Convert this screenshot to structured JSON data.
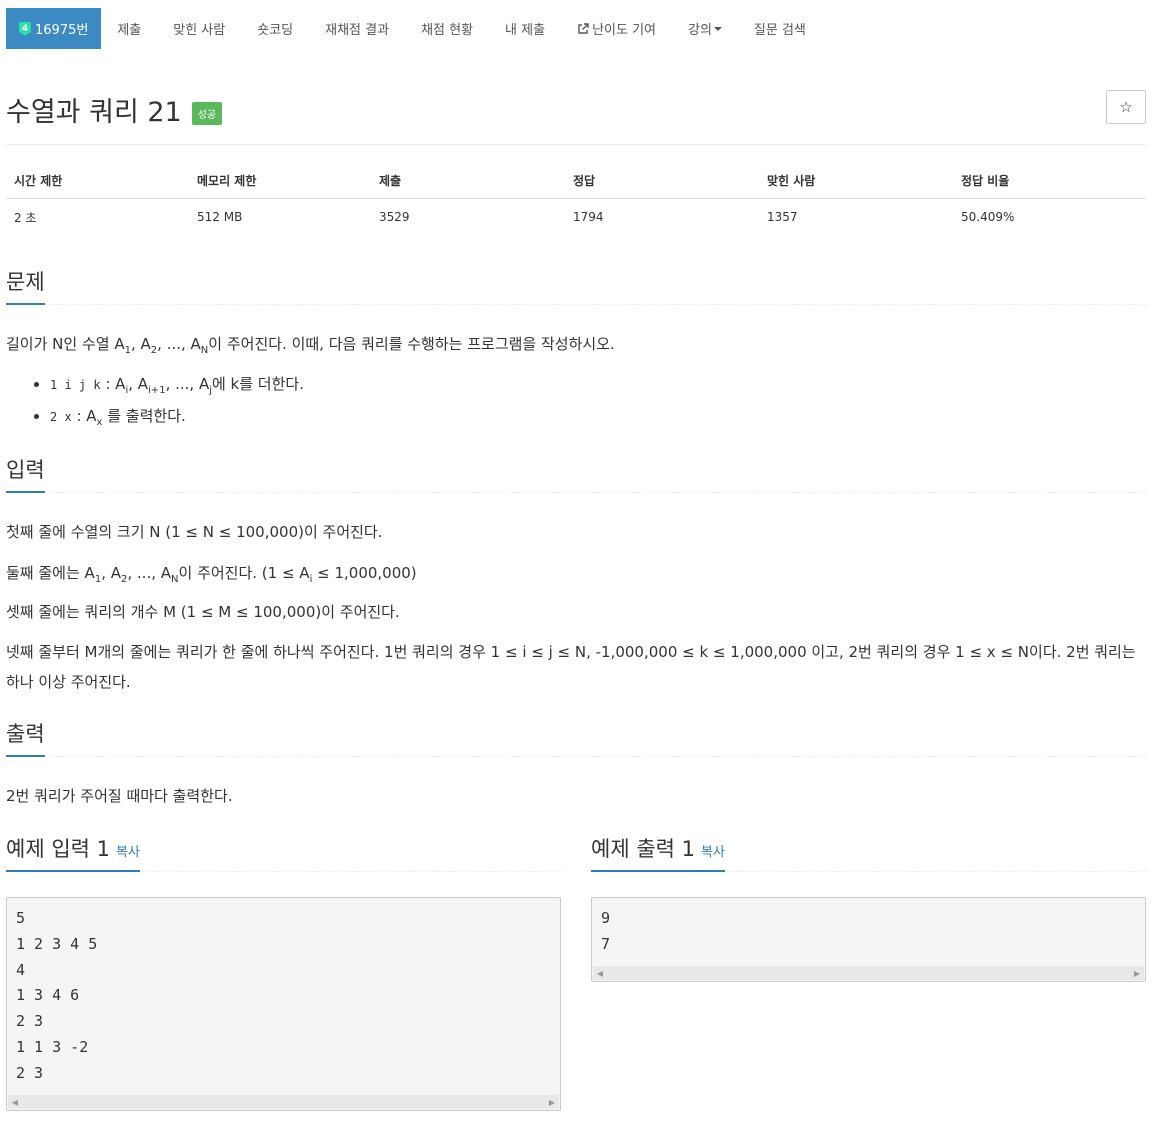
{
  "nav": {
    "problem_no": "16975번",
    "tier_icon": "4",
    "items": [
      "제출",
      "맞힌 사람",
      "숏코딩",
      "재채점 결과",
      "채점 현황",
      "내 제출",
      "난이도 기여",
      "강의"
    ],
    "search": "질문 검색"
  },
  "title": "수열과 쿼리 21",
  "result_badge": "성공",
  "star_icon": "☆",
  "info": {
    "headers": [
      "시간 제한",
      "메모리 제한",
      "제출",
      "정답",
      "맞힌 사람",
      "정답 비율"
    ],
    "values": [
      "2 초",
      "512 MB",
      "3529",
      "1794",
      "1357",
      "50.409%"
    ]
  },
  "sections": {
    "problem": "문제",
    "input": "입력",
    "output": "출력",
    "sample_input": "예제 입력 1",
    "sample_output": "예제 출력 1",
    "copy": "복사"
  },
  "problem": {
    "p_prefix": "길이가 N인 수열 A",
    "p_suffix": "이 주어진다. 이때, 다음 쿼리를 수행하는 프로그램을 작성하시오.",
    "q1_code": "1 i j k",
    "q1_suffix": "에 k를 더한다.",
    "q2_code": "2 x",
    "q2_suffix": " 를 출력한다."
  },
  "input": {
    "line1": "첫째 줄에 수열의 크기 N (1 ≤ N ≤ 100,000)이 주어진다.",
    "line2_prefix": "둘째 줄에는 A",
    "line2_suffix": "이 주어진다. (1 ≤ A",
    "line2_end": " ≤ 1,000,000)",
    "line3": "셋째 줄에는 쿼리의 개수 M (1 ≤ M ≤ 100,000)이 주어진다.",
    "line4a": "넷째 줄부터 M개의 줄에는 쿼리가 한 줄에 하나씩 주어진다. 1번 쿼리의 경우 1 ≤ i ≤ j ≤ N, -1,000,000 ≤ k ≤ 1,000,000 이고, 2번 쿼리의 경우 1 ≤ x ≤ N이다. 2번 쿼리는",
    "line4b": "하나 이상 주어진다."
  },
  "output": {
    "line1": "2번 쿼리가 주어질 때마다 출력한다."
  },
  "sample_input": "5\n1 2 3 4 5\n4\n1 3 4 6\n2 3\n1 1 3 -2\n2 3",
  "sample_output": "9\n7"
}
